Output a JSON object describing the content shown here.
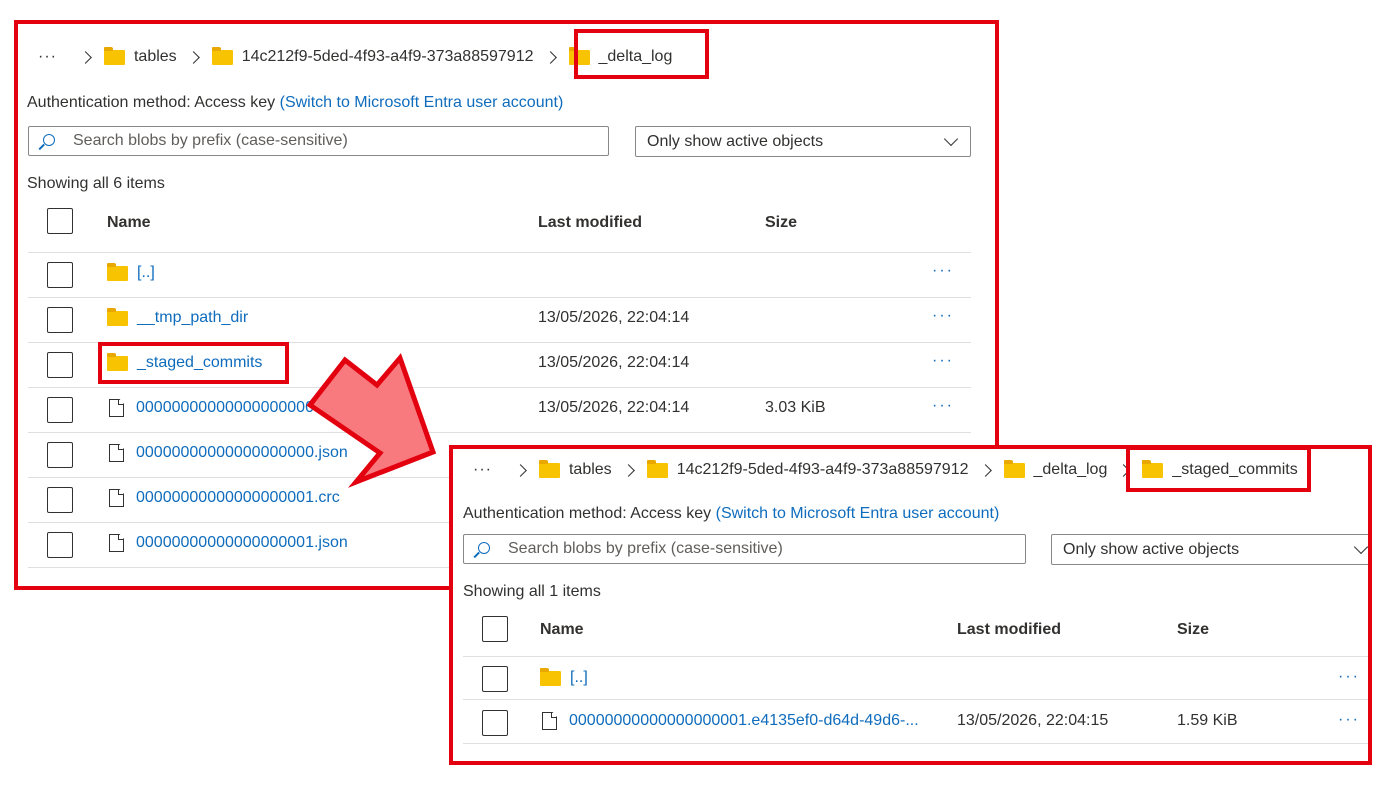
{
  "panel1": {
    "breadcrumb": {
      "more": "···",
      "items": [
        "tables",
        "14c212f9-5ded-4f93-a4f9-373a88597912",
        "_delta_log"
      ]
    },
    "auth": {
      "label": "Authentication method:",
      "value": "Access key",
      "switch_link": "(Switch to Microsoft Entra user account)"
    },
    "search_placeholder": "Search blobs by prefix (case-sensitive)",
    "filter": "Only show active objects",
    "count": "Showing all 6 items",
    "columns": {
      "name": "Name",
      "modified": "Last modified",
      "size": "Size"
    },
    "rows": [
      {
        "icon": "folder",
        "name": "[..]",
        "modified": "",
        "size": "",
        "more": "···"
      },
      {
        "icon": "folder",
        "name": "__tmp_path_dir",
        "modified": "13/05/2026, 22:04:14",
        "size": "",
        "more": "···"
      },
      {
        "icon": "folder",
        "name": "_staged_commits",
        "modified": "13/05/2026, 22:04:14",
        "size": "",
        "more": "···"
      },
      {
        "icon": "file",
        "name": "00000000000000000000.crc",
        "modified": "13/05/2026, 22:04:14",
        "size": "3.03 KiB",
        "more": "···"
      },
      {
        "icon": "file",
        "name": "00000000000000000000.json",
        "modified": "",
        "size": "",
        "more": ""
      },
      {
        "icon": "file",
        "name": "00000000000000000001.crc",
        "modified": "",
        "size": "",
        "more": ""
      },
      {
        "icon": "file",
        "name": "00000000000000000001.json",
        "modified": "",
        "size": "",
        "more": ""
      }
    ]
  },
  "panel2": {
    "breadcrumb": {
      "more": "···",
      "items": [
        "tables",
        "14c212f9-5ded-4f93-a4f9-373a88597912",
        "_delta_log",
        "_staged_commits"
      ]
    },
    "auth": {
      "label": "Authentication method:",
      "value": "Access key",
      "switch_link": "(Switch to Microsoft Entra user account)"
    },
    "search_placeholder": "Search blobs by prefix (case-sensitive)",
    "filter": "Only show active objects",
    "count": "Showing all 1 items",
    "columns": {
      "name": "Name",
      "modified": "Last modified",
      "size": "Size"
    },
    "rows": [
      {
        "icon": "folder",
        "name": "[..]",
        "modified": "",
        "size": "",
        "more": "···"
      },
      {
        "icon": "file",
        "name": "00000000000000000001.e4135ef0-d64d-49d6-...",
        "modified": "13/05/2026, 22:04:15",
        "size": "1.59 KiB",
        "more": "···"
      }
    ]
  },
  "colors": {
    "highlight": "#e3000f",
    "arrow_fill": "#f87a7e",
    "link": "#0f6cbd",
    "folder": "#f8c300"
  },
  "icons": {
    "folder": "folder-icon",
    "file": "file-icon",
    "search": "search-icon",
    "chevron": "chevron-right-icon",
    "dropdown": "chevron-down-icon",
    "more": "more-icon"
  }
}
